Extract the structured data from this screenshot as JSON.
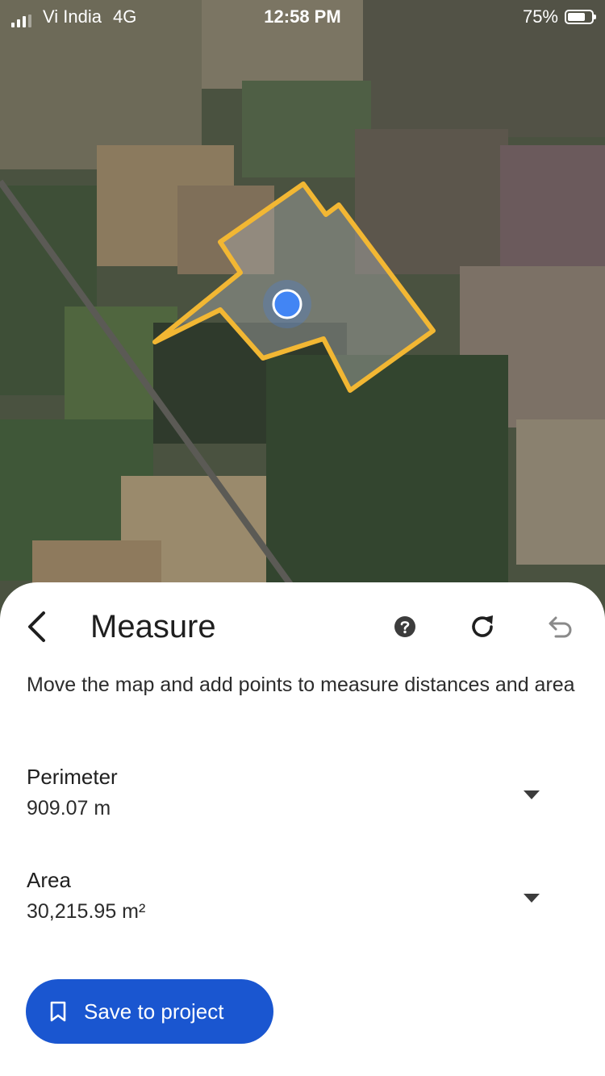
{
  "status_bar": {
    "carrier": "Vi India",
    "network": "4G",
    "time": "12:58 PM",
    "battery": "75%",
    "battery_level": 0.75
  },
  "map": {
    "view": "satellite",
    "polygon_color": "#f2b733",
    "location_dot_color": "#4285f4"
  },
  "panel": {
    "title": "Measure",
    "description": "Move the map and add points to measure distances and area",
    "icons": {
      "back": "chevron-left-icon",
      "help": "help-icon",
      "reset": "refresh-icon",
      "undo": "undo-icon"
    },
    "perimeter": {
      "label": "Perimeter",
      "value": "909.07 m"
    },
    "area": {
      "label": "Area",
      "value": "30,215.95 m²"
    },
    "save_button": {
      "label": "Save to project",
      "icon": "bookmark-icon",
      "color": "#1a56d0"
    }
  }
}
